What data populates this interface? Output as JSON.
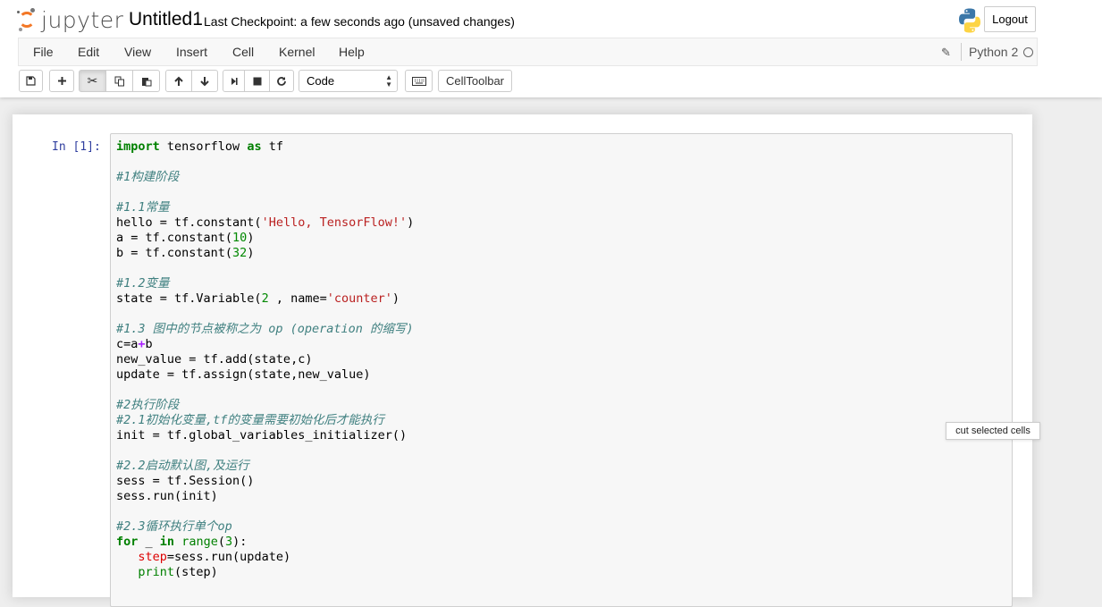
{
  "header": {
    "logo_text": "jupyter",
    "notebook_name": "Untitled1",
    "checkpoint": "Last Checkpoint: a few seconds ago (unsaved changes)",
    "logout_label": "Logout"
  },
  "menu": {
    "items": [
      "File",
      "Edit",
      "View",
      "Insert",
      "Cell",
      "Kernel",
      "Help"
    ],
    "kernel_name": "Python 2"
  },
  "toolbar": {
    "cell_type": "Code",
    "celltoolbar_label": "CellToolbar",
    "tooltip": "cut selected cells"
  },
  "cell": {
    "prompt": "In [1]:",
    "lines": [
      "import tensorflow as tf",
      "",
      "#1构建阶段",
      "",
      "#1.1常量",
      "hello = tf.constant('Hello, TensorFlow!')",
      "a = tf.constant(10)",
      "b = tf.constant(32)",
      "",
      "#1.2变量",
      "state = tf.Variable(2 , name='counter')",
      "",
      "#1.3 图中的节点被称之为 op (operation 的缩写)",
      "c=a+b",
      "new_value = tf.add(state,c)",
      "update = tf.assign(state,new_value)",
      "",
      "#2执行阶段",
      "#2.1初始化变量,tf的变量需要初始化后才能执行",
      "init = tf.global_variables_initializer()",
      "",
      "#2.2启动默认图,及运行",
      "sess = tf.Session()",
      "sess.run(init)",
      "",
      "#2.3循环执行单个op",
      "for _ in range(3):",
      "   step=sess.run(update)",
      "   print(step)"
    ]
  },
  "colors": {
    "keyword": "#008000",
    "string": "#ba2121",
    "comment": "#408080",
    "prompt": "#303f9f"
  }
}
